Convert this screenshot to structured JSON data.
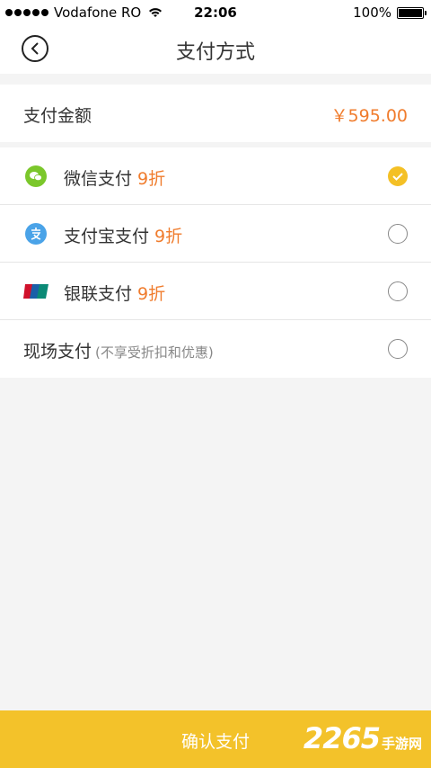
{
  "status_bar": {
    "carrier": "Vodafone RO",
    "time": "22:06",
    "battery": "100%",
    "battery_level": 1.0
  },
  "nav": {
    "title": "支付方式"
  },
  "amount": {
    "label": "支付金额",
    "value": "￥595.00"
  },
  "methods": [
    {
      "label": "微信支付",
      "discount": "9折",
      "icon": "wechat-pay-icon",
      "selected": true
    },
    {
      "label": "支付宝支付",
      "discount": "9折",
      "icon": "alipay-icon",
      "selected": false
    },
    {
      "label": "银联支付",
      "discount": "9折",
      "icon": "unionpay-icon",
      "selected": false
    },
    {
      "label": "现场支付",
      "note": "(不享受折扣和优惠)",
      "selected": false
    }
  ],
  "confirm": {
    "label": "确认支付"
  },
  "watermark": {
    "number": "2265",
    "text": "手游网"
  },
  "colors": {
    "accent": "#f3c22a",
    "price": "#f07c2d",
    "wechat": "#7bc72b",
    "alipay": "#4aa3e8",
    "unionpay_red": "#d0112b",
    "unionpay_blue": "#1b5fa8",
    "unionpay_green": "#0b8a76"
  }
}
